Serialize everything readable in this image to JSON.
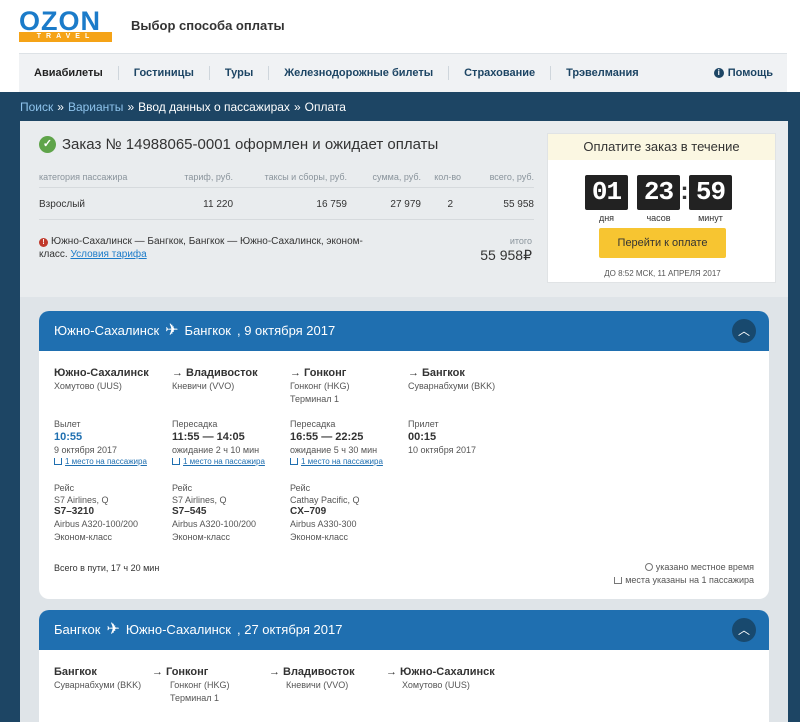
{
  "header": {
    "logo_text": "OZON",
    "logo_sub": "TRAVEL",
    "page_title": "Выбор способа оплаты"
  },
  "nav": {
    "items": [
      "Авиабилеты",
      "Гостиницы",
      "Туры",
      "Железнодорожные билеты",
      "Страхование",
      "Трэвелмания"
    ],
    "help": "Помощь"
  },
  "breadcrumbs": {
    "items": [
      "Поиск",
      "Варианты",
      "Ввод данных о пассажирах"
    ],
    "current": "Оплата",
    "sep": "»"
  },
  "order": {
    "title": "Заказ № 14988065-0001 оформлен и ожидает оплаты",
    "columns": [
      "категория пассажира",
      "тариф, руб.",
      "таксы и сборы, руб.",
      "сумма, руб.",
      "кол-во",
      "всего, руб."
    ],
    "row": [
      "Взрослый",
      "11 220",
      "16 759",
      "27 979",
      "2",
      "55 958"
    ],
    "route_note": "Южно-Сахалинск — Бангкок, Бангкок — Южно-Сахалинск, эконом-класс.",
    "tariff_link": "Условия тарифа",
    "total_label": "итого",
    "total_value": "55 958₽"
  },
  "payment": {
    "title": "Оплатите заказ в течение",
    "days": "01",
    "days_label": "дня",
    "hours": "23",
    "hours_label": "часов",
    "minutes": "59",
    "minutes_label": "минут",
    "button": "Перейти к оплате",
    "deadline": "ДО 8:52 МСК, 11 АПРЕЛЯ 2017"
  },
  "flight1": {
    "from": "Южно-Сахалинск",
    "to": "Бангкок",
    "date": "9 октября 2017",
    "segments": [
      {
        "city": "Южно-Сахалинск",
        "airport": "Хомутово (UUS)",
        "terminal": "",
        "time_label": "Вылет",
        "time": "10:55",
        "date": "9 октября 2017",
        "seat": "1 место на пассажира",
        "flight_label": "Рейс",
        "airline": "S7 Airlines, Q",
        "flight_no": "S7–3210",
        "aircraft": "Airbus A320-100/200",
        "class": "Эконом-класс"
      },
      {
        "city": "Владивосток",
        "airport": "Кневичи (VVO)",
        "terminal": "",
        "time_label": "Пересадка",
        "time": "11:55 — 14:05",
        "date": "ожидание 2 ч 10 мин",
        "seat": "1 место на пассажира",
        "flight_label": "Рейс",
        "airline": "S7 Airlines, Q",
        "flight_no": "S7–545",
        "aircraft": "Airbus A320-100/200",
        "class": "Эконом-класс"
      },
      {
        "city": "Гонконг",
        "airport": "Гонконг (HKG)",
        "terminal": "Терминал 1",
        "time_label": "Пересадка",
        "time": "16:55 — 22:25",
        "date": "ожидание 5 ч 30 мин",
        "seat": "1 место на пассажира",
        "flight_label": "Рейс",
        "airline": "Cathay Pacific, Q",
        "flight_no": "CX–709",
        "aircraft": "Airbus A330-300",
        "class": "Эконом-класс"
      },
      {
        "city": "Бангкок",
        "airport": "Суварнабхуми (BKK)",
        "terminal": "",
        "time_label": "Прилет",
        "time": "00:15",
        "date": "10 октября 2017"
      }
    ],
    "total_time": "Всего в пути, 17 ч 20 мин",
    "legend_time": "указано местное время",
    "legend_seats": "места указаны на 1 пассажира"
  },
  "flight2": {
    "from": "Бангкок",
    "to": "Южно-Сахалинск",
    "date": "27 октября 2017",
    "segments": [
      {
        "city": "Бангкок",
        "airport": "Суварнабхуми (BKK)",
        "terminal": ""
      },
      {
        "city": "Гонконг",
        "airport": "Гонконг (HKG)",
        "terminal": "Терминал 1"
      },
      {
        "city": "Владивосток",
        "airport": "Кневичи (VVO)",
        "terminal": ""
      },
      {
        "city": "Южно-Сахалинск",
        "airport": "Хомутово (UUS)",
        "terminal": ""
      }
    ]
  },
  "colors": {
    "primary": "#1f6fb0",
    "dark": "#1d4564",
    "pay_button": "#f7c531",
    "success": "#5fa44a"
  }
}
